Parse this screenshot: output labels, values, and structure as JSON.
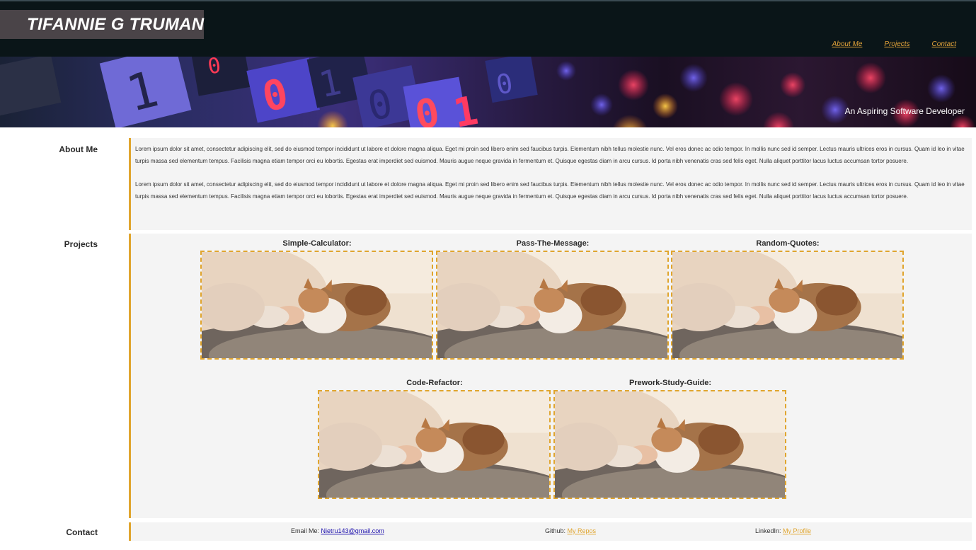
{
  "header": {
    "brand": "TIFANNIE G TRUMAN",
    "nav": [
      "About Me",
      "Projects",
      "Contact"
    ]
  },
  "hero": {
    "tagline": "An Aspiring Software Developer"
  },
  "about": {
    "label": "About Me",
    "paragraphs": [
      "Lorem ipsum dolor sit amet, consectetur adipiscing elit, sed do eiusmod tempor incididunt ut labore et dolore magna aliqua. Eget mi proin sed libero enim sed faucibus turpis. Elementum nibh tellus molestie nunc. Vel eros donec ac odio tempor. In mollis nunc sed id semper. Lectus mauris ultrices eros in cursus. Quam id leo in vitae turpis massa sed elementum tempus. Facilisis magna etiam tempor orci eu lobortis. Egestas erat imperdiet sed euismod. Mauris augue neque gravida in fermentum et. Quisque egestas diam in arcu cursus. Id porta nibh venenatis cras sed felis eget. Nulla aliquet porttitor lacus luctus accumsan tortor posuere.",
      "Lorem ipsum dolor sit amet, consectetur adipiscing elit, sed do eiusmod tempor incididunt ut labore et dolore magna aliqua. Eget mi proin sed libero enim sed faucibus turpis. Elementum nibh tellus molestie nunc. Vel eros donec ac odio tempor. In mollis nunc sed id semper. Lectus mauris ultrices eros in cursus. Quam id leo in vitae turpis massa sed elementum tempus. Facilisis magna etiam tempor orci eu lobortis. Egestas erat imperdiet sed euismod. Mauris augue neque gravida in fermentum et. Quisque egestas diam in arcu cursus. Id porta nibh venenatis cras sed felis eget. Nulla aliquet porttitor lacus luctus accumsan tortor posuere."
    ]
  },
  "projects": {
    "label": "Projects",
    "items": [
      {
        "title": "Simple-Calculator:"
      },
      {
        "title": "Pass-The-Message:"
      },
      {
        "title": "Random-Quotes:"
      },
      {
        "title": "Code-Refactor:"
      },
      {
        "title": "Prework-Study-Guide:"
      }
    ]
  },
  "contact": {
    "label": "Contact",
    "email_prefix": "Email Me:",
    "email": "Nietru143@gmail.com",
    "github_prefix": "Github:",
    "github_link": "My Repos",
    "linkedin_prefix": "LinkedIn:",
    "linkedin_link": "My Profile"
  },
  "colors": {
    "accent": "#e0a52e",
    "header_bg": "#0a1518",
    "panel_bg": "#f4f4f4"
  }
}
